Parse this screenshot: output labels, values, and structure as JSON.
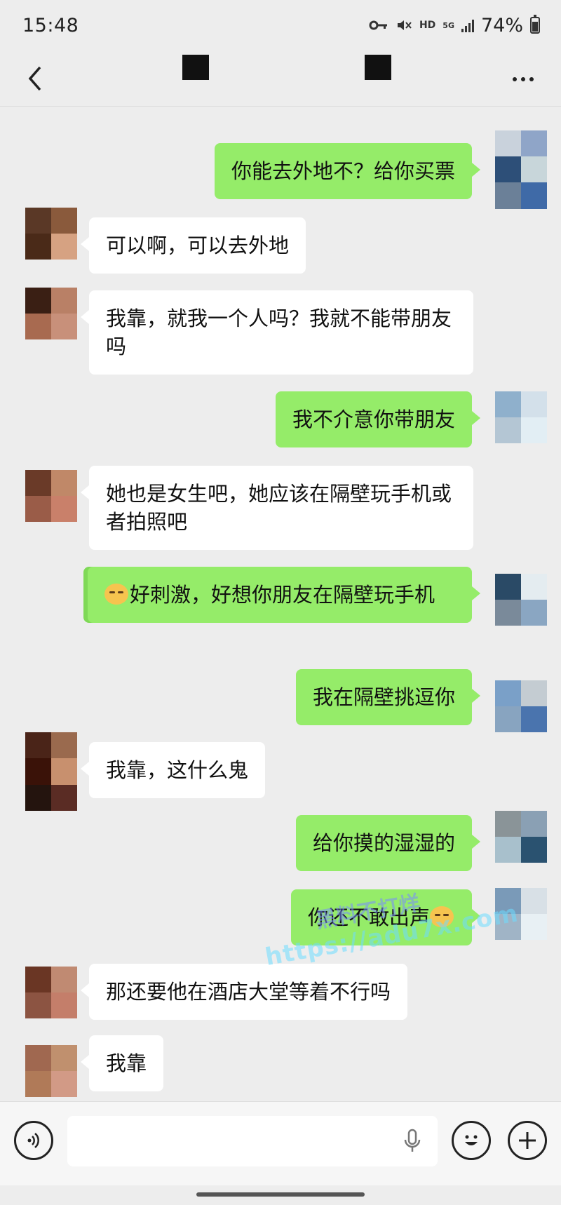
{
  "status_bar": {
    "time": "15:48",
    "network_hd": "HD",
    "network_gen": "5G",
    "battery_percent": "74%",
    "icons": [
      "vpn-key-icon",
      "mute-icon",
      "signal-icon",
      "battery-icon"
    ]
  },
  "header": {
    "back_icon": "chevron-left-icon",
    "more_icon": "more-dots-icon"
  },
  "messages": [
    {
      "side": "out",
      "text": "你能去外地不？给你买票"
    },
    {
      "side": "in",
      "text": "可以啊，可以去外地"
    },
    {
      "side": "in",
      "text": "我靠，就我一个人吗？我就不能带朋友吗"
    },
    {
      "side": "out",
      "text": "我不介意你带朋友"
    },
    {
      "side": "in",
      "text": "她也是女生吧，她应该在隔壁玩手机或者拍照吧"
    },
    {
      "side": "out",
      "text": "好刺激，好想你朋友在隔壁玩手机",
      "emoji": "dog-face-emoji"
    },
    {
      "side": "out",
      "text": "我在隔壁挑逗你"
    },
    {
      "side": "in",
      "text": "我靠，这什么鬼"
    },
    {
      "side": "out",
      "text": "给你摸的湿湿的"
    },
    {
      "side": "out",
      "text": "你还不敢出声",
      "emoji": "dog-face-emoji"
    },
    {
      "side": "in",
      "text": "那还要他在酒店大堂等着不行吗"
    },
    {
      "side": "in",
      "text": "我靠"
    }
  ],
  "watermark": {
    "line1": "黑料不打烊",
    "line2": "https://adu7x.com"
  },
  "input_bar": {
    "placeholder": "",
    "icons": [
      "voice-icon",
      "microphone-icon",
      "emoji-icon",
      "plus-icon"
    ]
  },
  "colors": {
    "background": "#ededed",
    "outgoing_bubble": "#95ec69",
    "incoming_bubble": "#ffffff"
  }
}
